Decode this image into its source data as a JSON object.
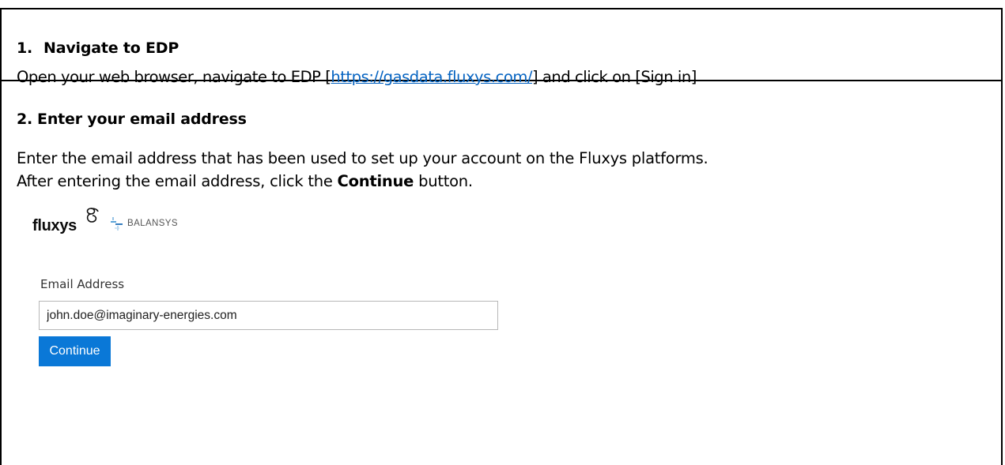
{
  "steps": [
    {
      "number": "1.",
      "title": "Navigate to EDP",
      "body_prefix": "Open your web browser, navigate to EDP [",
      "link_text": "https://gasdata.fluxys.com/",
      "body_suffix": "] and click on [Sign in]"
    },
    {
      "number": "2.",
      "title": "Enter your email address",
      "body_line1": "Enter the email address that has been used to set up your account on the Fluxys platforms.",
      "body_line2_prefix": "After entering the email address, click the ",
      "body_line2_bold": "Continue",
      "body_line2_suffix": " button."
    }
  ],
  "login_screenshot": {
    "brand_primary": "fluxys",
    "brand_secondary": "BALANSYS",
    "email_label": "Email Address",
    "email_value": "john.doe@imaginary-energies.com",
    "continue_label": "Continue"
  },
  "colors": {
    "link": "#0563c1",
    "continue_button": "#0a78d7",
    "balansys_mark": "#4a9ad4"
  },
  "icons": {
    "fluxys": "fluxys-logo-icon",
    "balansys": "balansys-logo-icon"
  }
}
